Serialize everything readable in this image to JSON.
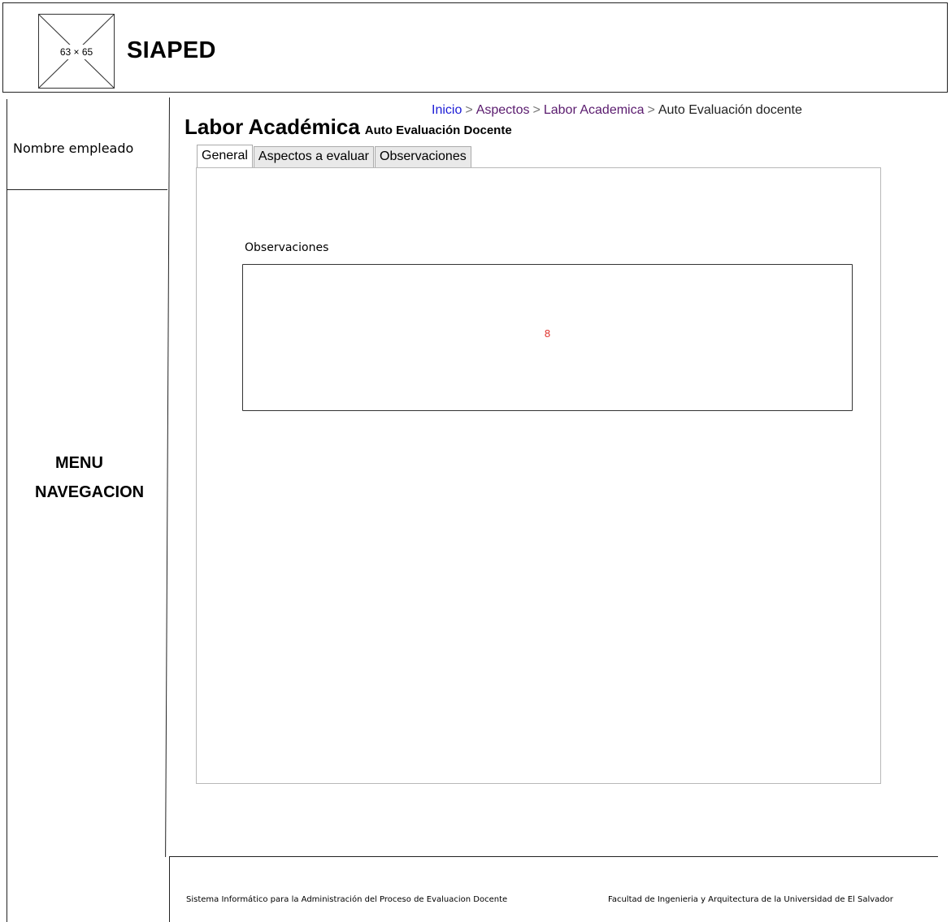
{
  "header": {
    "logo_placeholder": "63 × 65",
    "app_title": "SIAPED"
  },
  "sidebar": {
    "employee_name": "Nombre empleado",
    "menu_line1": "MENU",
    "menu_line2": "NAVEGACION"
  },
  "breadcrumb": {
    "items": [
      "Inicio",
      "Aspectos",
      "Labor Academica",
      "Auto Evaluación docente"
    ],
    "separator": ">"
  },
  "page": {
    "title": "Labor Académica",
    "subtitle": "Auto Evaluación Docente"
  },
  "tabs": [
    {
      "label": "General",
      "active": true
    },
    {
      "label": "Aspectos a evaluar",
      "active": false
    },
    {
      "label": "Observaciones",
      "active": false
    }
  ],
  "observations": {
    "label": "Observaciones",
    "value": "8"
  },
  "footer": {
    "left": "Sistema Informático para la Administración del Proceso de Evaluacion Docente",
    "right": "Facultad de Ingenieria y Arquitectura de la Universidad de El Salvador"
  },
  "colors": {
    "link": "#1c1cd6",
    "visited_link": "#5a1b6e",
    "value_red": "#e0302a"
  }
}
